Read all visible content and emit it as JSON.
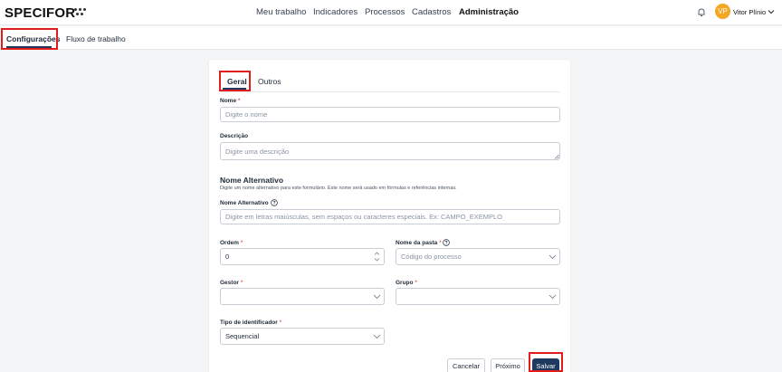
{
  "header": {
    "logo": "SPECIFOR",
    "nav": [
      "Meu trabalho",
      "Indicadores",
      "Processos",
      "Cadastros",
      "Administração"
    ],
    "active_nav": "Administração",
    "user_initials": "VP",
    "user_name": "Vitor Plínio"
  },
  "subnav": {
    "tabs": [
      "Configurações",
      "Fluxo de trabalho"
    ]
  },
  "form": {
    "tabs": [
      "Geral",
      "Outros"
    ],
    "nome": {
      "label": "Nome",
      "placeholder": "Digite o nome"
    },
    "descricao": {
      "label": "Descrição",
      "placeholder": "Digite uma descrição"
    },
    "alt_section": {
      "title": "Nome Alternativo",
      "description": "Digite um nome alternativo para este formulário. Este nome será usado em fórmulas e referências internas."
    },
    "nome_alternativo": {
      "label": "Nome Alternativo",
      "placeholder": "Digite em letras maiúsculas, sem espaços ou caracteres especiais. Ex: CAMPO_EXEMPLO"
    },
    "ordem": {
      "label": "Ordem",
      "value": "0"
    },
    "nome_pasta": {
      "label": "Nome da pasta",
      "placeholder": "Código do processo"
    },
    "gestor": {
      "label": "Gestor",
      "value": ""
    },
    "grupo": {
      "label": "Grupo",
      "value": ""
    },
    "tipo_identificador": {
      "label": "Tipo de identificador",
      "value": "Sequencial"
    },
    "required_mark": "*"
  },
  "actions": {
    "cancel": "Cancelar",
    "next": "Próximo",
    "save": "Salvar"
  },
  "colors": {
    "primary": "#1e3a5f",
    "highlight": "#e21b1b",
    "avatar": "#f5a623"
  }
}
